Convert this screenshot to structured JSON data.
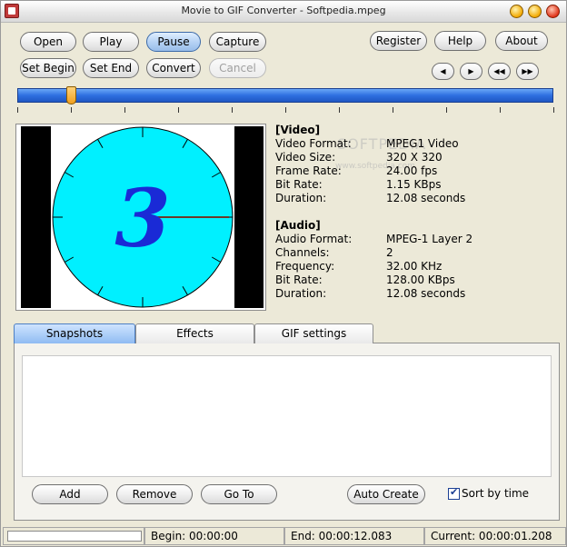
{
  "window": {
    "title": "Movie to GIF Converter - Softpedia.mpeg"
  },
  "toolbar": {
    "open": "Open",
    "play": "Play",
    "pause": "Pause",
    "capture": "Capture",
    "set_begin": "Set Begin",
    "set_end": "Set End",
    "convert": "Convert",
    "cancel": "Cancel",
    "register": "Register",
    "help": "Help",
    "about": "About"
  },
  "nav": {
    "prev": "◀",
    "next": "▶",
    "rewind": "◀◀",
    "forward": "▶▶"
  },
  "slider": {
    "position_fraction": 0.1
  },
  "preview": {
    "frame_digit": "3"
  },
  "watermark": {
    "text": "SOFTPEDIA",
    "sub": "www.softpedia.com"
  },
  "video_info": {
    "heading": "[Video]",
    "rows": [
      {
        "label": "Video Format:",
        "value": "MPEG1 Video"
      },
      {
        "label": "Video Size:",
        "value": "320 X 320"
      },
      {
        "label": "Frame Rate:",
        "value": "24.00 fps"
      },
      {
        "label": "Bit Rate:",
        "value": "1.15 KBps"
      },
      {
        "label": "Duration:",
        "value": "12.08 seconds"
      }
    ]
  },
  "audio_info": {
    "heading": "[Audio]",
    "rows": [
      {
        "label": "Audio Format:",
        "value": "MPEG-1 Layer 2"
      },
      {
        "label": "Channels:",
        "value": "2"
      },
      {
        "label": "Frequency:",
        "value": "32.00 KHz"
      },
      {
        "label": "Bit Rate:",
        "value": "128.00 KBps"
      },
      {
        "label": "Duration:",
        "value": "12.08 seconds"
      }
    ]
  },
  "tabs": [
    {
      "label": "Snapshots",
      "selected": true
    },
    {
      "label": "Effects",
      "selected": false
    },
    {
      "label": "GIF settings",
      "selected": false
    }
  ],
  "snapshots": {
    "add": "Add",
    "remove": "Remove",
    "go_to": "Go To",
    "auto_create": "Auto Create",
    "sort_by_time": "Sort by time",
    "sort_checked": true
  },
  "status": {
    "begin": "Begin: 00:00:00",
    "end": "End: 00:00:12.083",
    "current": "Current: 00:00:01.208",
    "progress_fraction": 0
  },
  "colors": {
    "accent": "#2e6fe0",
    "clock_face": "#00f0ff",
    "digit": "#1a2ad6"
  }
}
